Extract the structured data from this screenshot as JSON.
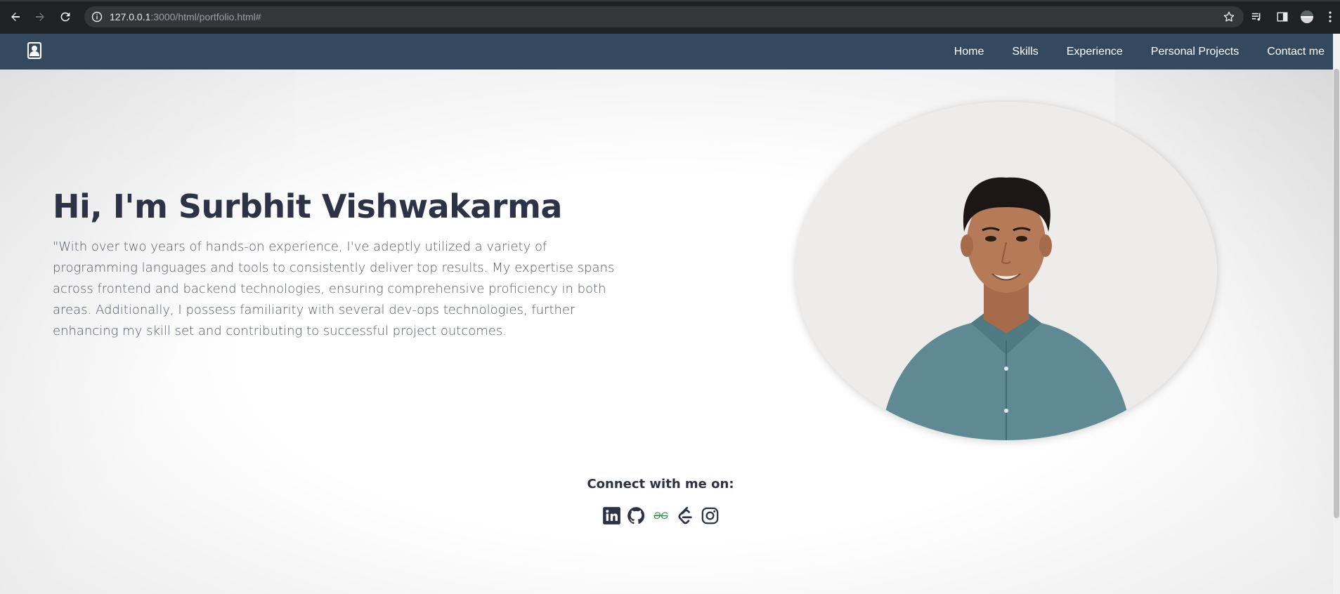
{
  "browser": {
    "url_host": "127.0.0.1",
    "url_rest": ":3000/html/portfolio.html#",
    "back_icon": "arrow-left-icon",
    "forward_icon": "arrow-right-icon",
    "reload_icon": "reload-icon"
  },
  "nav": {
    "logo_icon": "portrait-icon",
    "links": [
      "Home",
      "Skills",
      "Experience",
      "Personal Projects",
      "Contact me"
    ]
  },
  "hero": {
    "headline": "Hi, I'm Surbhit Vishwakarma",
    "bio": "\"With over two years of hands-on experience, I've adeptly utilized a variety of programming languages and tools to consistently deliver top results. My expertise spans across frontend and backend technologies, ensuring comprehensive proficiency in both areas. Additionally, I possess familiarity with several dev-ops technologies, further enhancing my skill set and contributing to successful project outcomes."
  },
  "connect": {
    "title": "Connect with me on:",
    "icons": [
      "linkedin-icon",
      "github-icon",
      "geeksforgeeks-icon",
      "leetcode-icon",
      "instagram-icon"
    ]
  },
  "colors": {
    "navbar": "#34495e",
    "heading": "#2c3347",
    "geeksforgeeks": "#2f8d46"
  }
}
